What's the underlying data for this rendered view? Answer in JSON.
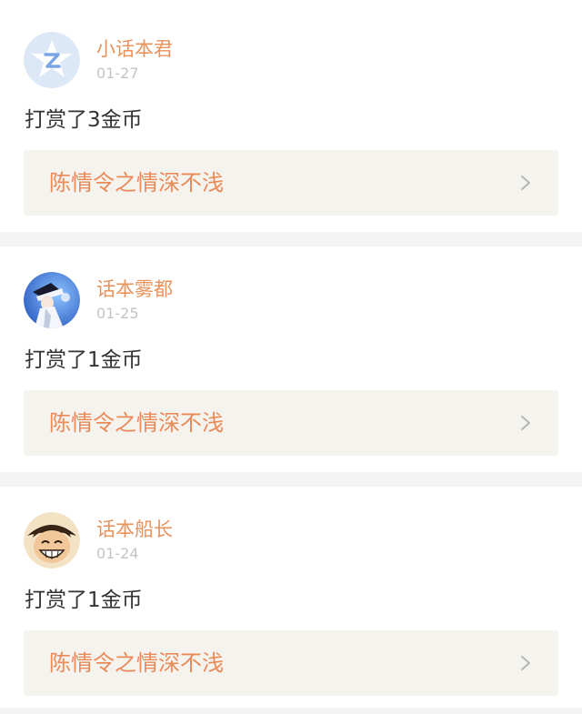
{
  "entries": [
    {
      "user": "小话本君",
      "date": "01-27",
      "action": "打赏了3金币",
      "book": "陈情令之情深不浅",
      "avatar_icon": "star-logo-icon",
      "avatar_color": "#6d9be0"
    },
    {
      "user": "话本雾都",
      "date": "01-25",
      "action": "打赏了1金币",
      "book": "陈情令之情深不浅",
      "avatar_icon": "anime-character-avatar",
      "avatar_color": "#3a6fd1"
    },
    {
      "user": "话本船长",
      "date": "01-24",
      "action": "打赏了1金币",
      "book": "陈情令之情深不浅",
      "avatar_icon": "straw-hat-boy-avatar",
      "avatar_color": "#8a5a2e"
    }
  ],
  "colors": {
    "accent": "#e8925c",
    "book_bar_bg": "#f4f3ee",
    "date_gray": "#c4c4c4",
    "text_dark": "#333333"
  }
}
